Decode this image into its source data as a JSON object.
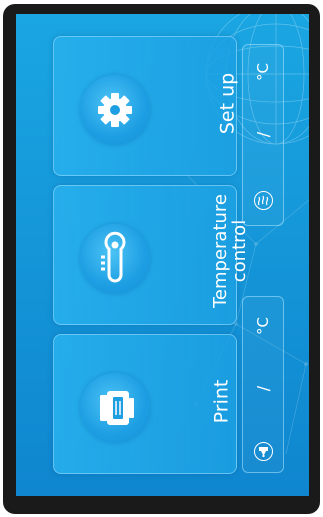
{
  "panels": {
    "setup": {
      "label": "Set up",
      "icon": "gear-icon"
    },
    "temperature": {
      "label": "Temperature control",
      "icon": "thermometer-icon"
    },
    "print": {
      "label": "Print",
      "icon": "printer-icon"
    }
  },
  "status": {
    "chamber": {
      "icon": "heater-icon",
      "separator": "/",
      "unit": "°C"
    },
    "nozzle": {
      "icon": "nozzle-icon",
      "separator": "/",
      "unit": "°C"
    }
  },
  "colors": {
    "screen": "#1597d9",
    "bezel": "#1a1a1a",
    "text": "#ffffff"
  }
}
